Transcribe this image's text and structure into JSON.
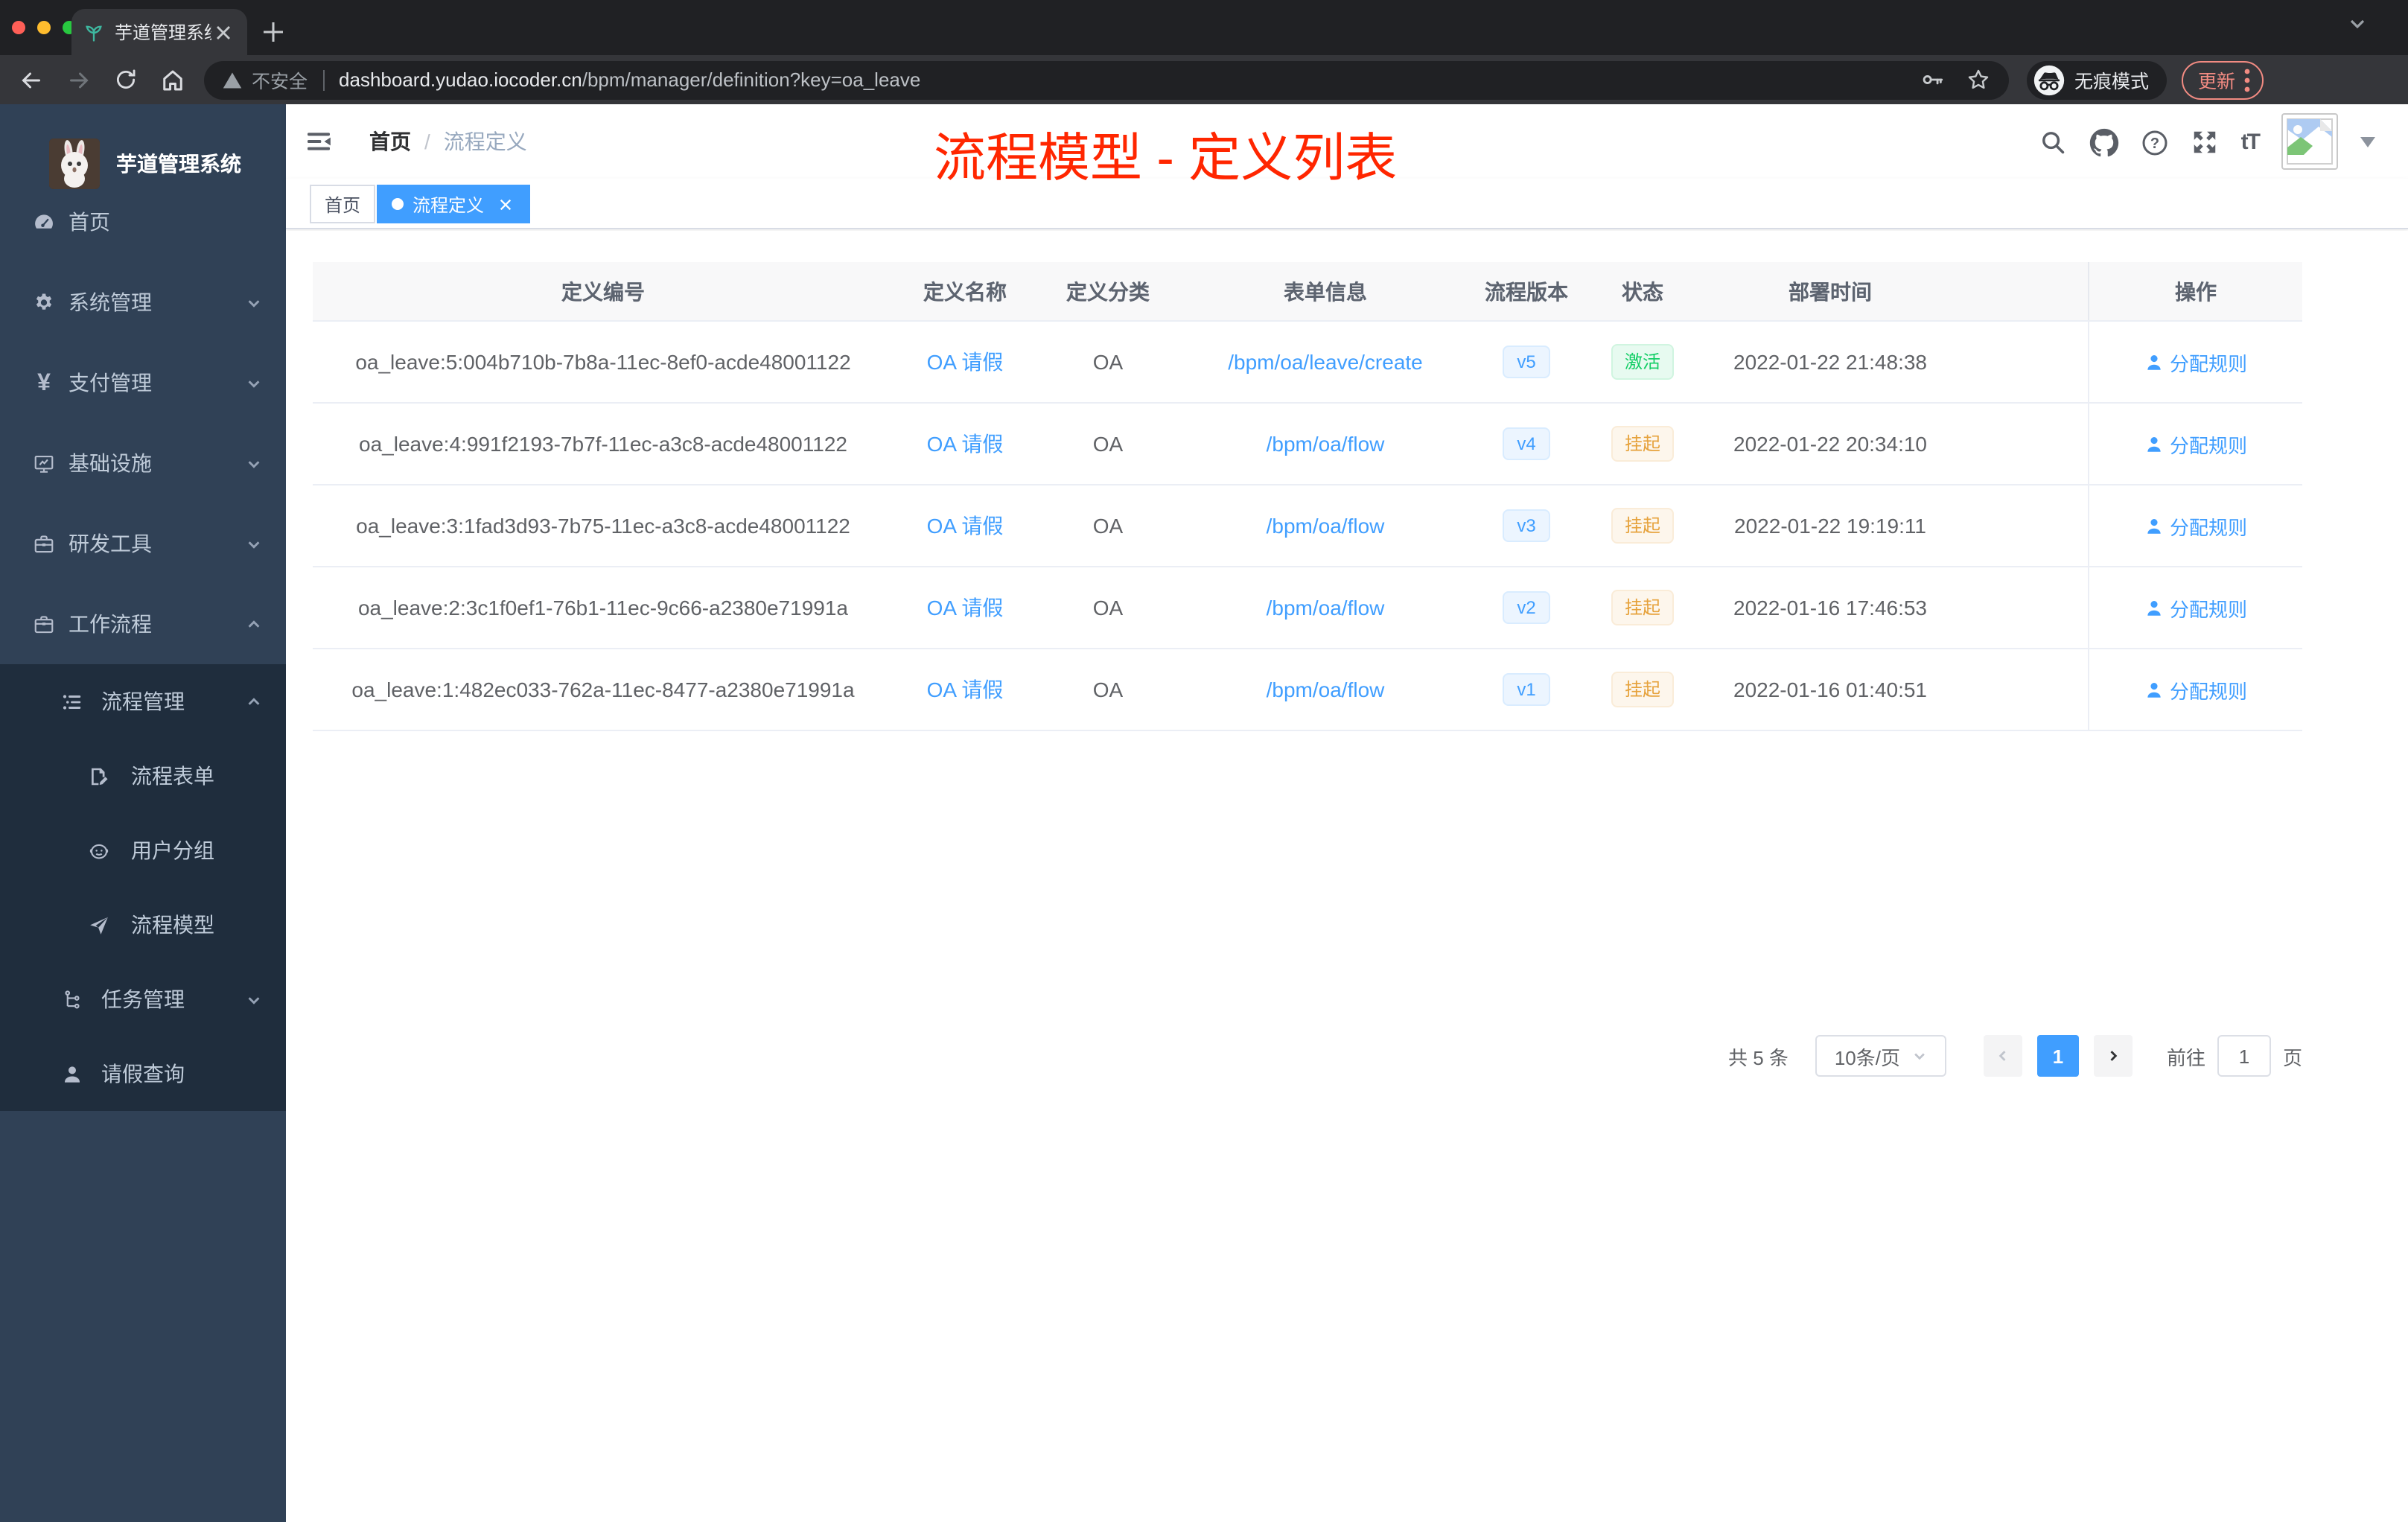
{
  "browser": {
    "tab_title": "芋道管理系统",
    "security_label": "不安全",
    "url_domain": "dashboard.yudao.iocoder.cn",
    "url_path": "/bpm/manager/definition?key=oa_leave",
    "incognito_label": "无痕模式",
    "update_label": "更新"
  },
  "annotation": {
    "title": "流程模型 - 定义列表",
    "color": "#ff2600"
  },
  "sidebar": {
    "logo_title": "芋道管理系统",
    "items": [
      {
        "label": "首页"
      },
      {
        "label": "系统管理"
      },
      {
        "label": "支付管理"
      },
      {
        "label": "基础设施"
      },
      {
        "label": "研发工具"
      },
      {
        "label": "工作流程"
      }
    ],
    "submenu": [
      {
        "label": "流程管理"
      },
      {
        "label": "流程表单"
      },
      {
        "label": "用户分组"
      },
      {
        "label": "流程模型"
      },
      {
        "label": "任务管理"
      },
      {
        "label": "请假查询"
      }
    ]
  },
  "navbar": {
    "breadcrumb_home": "首页",
    "breadcrumb_separator": "/",
    "breadcrumb_current": "流程定义"
  },
  "tags": {
    "home": {
      "label": "首页"
    },
    "active": {
      "label": "流程定义"
    }
  },
  "glyphs": {
    "yen": "¥",
    "font_size": "tT",
    "question": "?"
  },
  "table": {
    "columns": [
      "定义编号",
      "定义名称",
      "定义分类",
      "表单信息",
      "流程版本",
      "状态",
      "部署时间",
      "操作"
    ],
    "action_label": "分配规则",
    "rows": [
      {
        "id": "oa_leave:5:004b710b-7b8a-11ec-8ef0-acde48001122",
        "name": "OA 请假",
        "category": "OA",
        "form": "/bpm/oa/leave/create",
        "version": "v5",
        "status": "激活",
        "status_type": "success",
        "deploy_time": "2022-01-22 21:48:38"
      },
      {
        "id": "oa_leave:4:991f2193-7b7f-11ec-a3c8-acde48001122",
        "name": "OA 请假",
        "category": "OA",
        "form": "/bpm/oa/flow",
        "version": "v4",
        "status": "挂起",
        "status_type": "warning",
        "deploy_time": "2022-01-22 20:34:10"
      },
      {
        "id": "oa_leave:3:1fad3d93-7b75-11ec-a3c8-acde48001122",
        "name": "OA 请假",
        "category": "OA",
        "form": "/bpm/oa/flow",
        "version": "v3",
        "status": "挂起",
        "status_type": "warning",
        "deploy_time": "2022-01-22 19:19:11"
      },
      {
        "id": "oa_leave:2:3c1f0ef1-76b1-11ec-9c66-a2380e71991a",
        "name": "OA 请假",
        "category": "OA",
        "form": "/bpm/oa/flow",
        "version": "v2",
        "status": "挂起",
        "status_type": "warning",
        "deploy_time": "2022-01-16 17:46:53"
      },
      {
        "id": "oa_leave:1:482ec033-762a-11ec-8477-a2380e71991a",
        "name": "OA 请假",
        "category": "OA",
        "form": "/bpm/oa/flow",
        "version": "v1",
        "status": "挂起",
        "status_type": "warning",
        "deploy_time": "2022-01-16 01:40:51"
      }
    ]
  },
  "pagination": {
    "total": "共 5 条",
    "page_size": "10条/页",
    "current_page": "1",
    "goto_label": "前往",
    "goto_value": "1",
    "page_unit": "页"
  }
}
